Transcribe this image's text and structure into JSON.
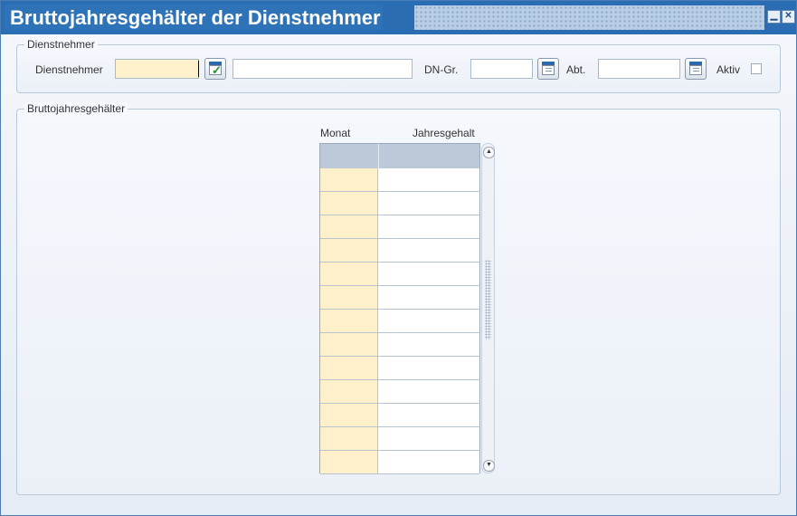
{
  "window": {
    "title": "Bruttojahresgehälter der Dienstnehmer",
    "minimize_symbol": "▁",
    "close_symbol": "✕"
  },
  "dienstnehmer_group": {
    "legend": "Dienstnehmer",
    "dienstnehmer_label": "Dienstnehmer",
    "dienstnehmer_code": "",
    "dienstnehmer_name": "",
    "dngr_label": "DN-Gr.",
    "dngr_value": "",
    "abt_label": "Abt.",
    "abt_value": "",
    "aktiv_label": "Aktiv",
    "aktiv_checked": false
  },
  "gehaelter_group": {
    "legend": "Bruttojahresgehälter",
    "columns": [
      "Monat",
      "Jahresgehalt"
    ],
    "rows": [
      {
        "monat": "",
        "gehalt": ""
      },
      {
        "monat": "",
        "gehalt": ""
      },
      {
        "monat": "",
        "gehalt": ""
      },
      {
        "monat": "",
        "gehalt": ""
      },
      {
        "monat": "",
        "gehalt": ""
      },
      {
        "monat": "",
        "gehalt": ""
      },
      {
        "monat": "",
        "gehalt": ""
      },
      {
        "monat": "",
        "gehalt": ""
      },
      {
        "monat": "",
        "gehalt": ""
      },
      {
        "monat": "",
        "gehalt": ""
      },
      {
        "monat": "",
        "gehalt": ""
      },
      {
        "monat": "",
        "gehalt": ""
      },
      {
        "monat": "",
        "gehalt": ""
      }
    ],
    "scroll_up_symbol": "▲",
    "scroll_down_symbol": "▼"
  },
  "icons": {
    "lookup_check": "check-lookup-icon",
    "lookup_list": "list-lookup-icon"
  },
  "colors": {
    "title_bar": "#2a6db2",
    "required_field": "#fff1cc",
    "grid_header": "#bdc9d8"
  }
}
